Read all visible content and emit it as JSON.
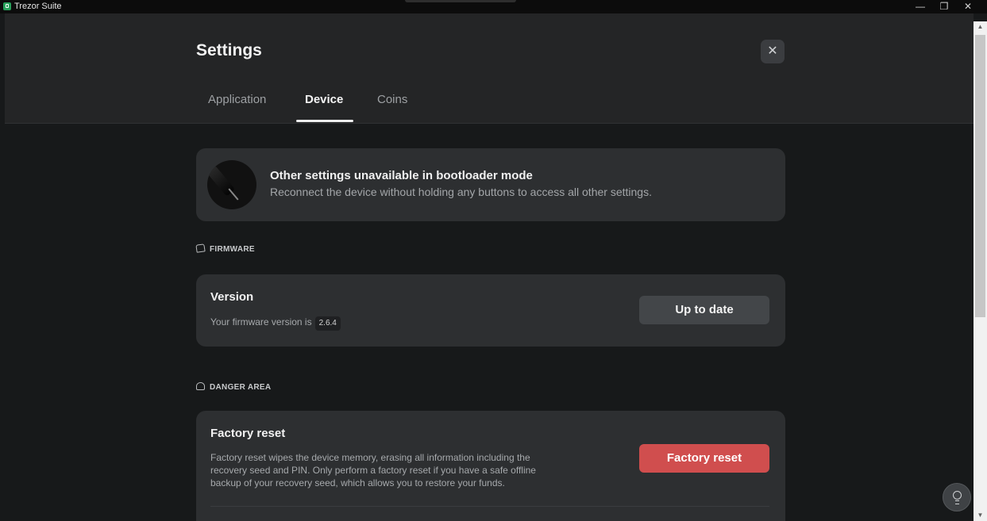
{
  "window": {
    "title": "Trezor Suite",
    "minimize_glyph": "—",
    "restore_glyph": "❐",
    "close_glyph": "✕"
  },
  "header": {
    "title": "Settings",
    "close_glyph": "✕",
    "tabs": [
      {
        "label": "Application",
        "active": false
      },
      {
        "label": "Device",
        "active": true
      },
      {
        "label": "Coins",
        "active": false
      }
    ]
  },
  "banner": {
    "title": "Other settings unavailable in bootloader mode",
    "subtitle": "Reconnect the device without holding any buttons to access all other settings."
  },
  "firmware": {
    "section_label": "FIRMWARE",
    "card_title": "Version",
    "desc": "Your firmware version is",
    "version": "2.6.4",
    "button_label": "Up to date"
  },
  "danger": {
    "section_label": "DANGER AREA",
    "card_title": "Factory reset",
    "desc_lines": [
      "Factory reset wipes the device memory, erasing all information including the",
      "recovery seed and PIN. Only perform a factory reset if you have a safe offline",
      "backup of your recovery seed, which allows you to restore your funds."
    ],
    "button_label": "Factory reset"
  },
  "colors": {
    "accent_danger": "#d04e4e",
    "app_icon": "#27a05a",
    "background": "#17191a",
    "card": "#2d2f31"
  },
  "icons": {
    "app": "trezor-icon",
    "firmware": "firmware-icon",
    "danger": "ghost-icon",
    "help": "lightbulb-icon"
  }
}
